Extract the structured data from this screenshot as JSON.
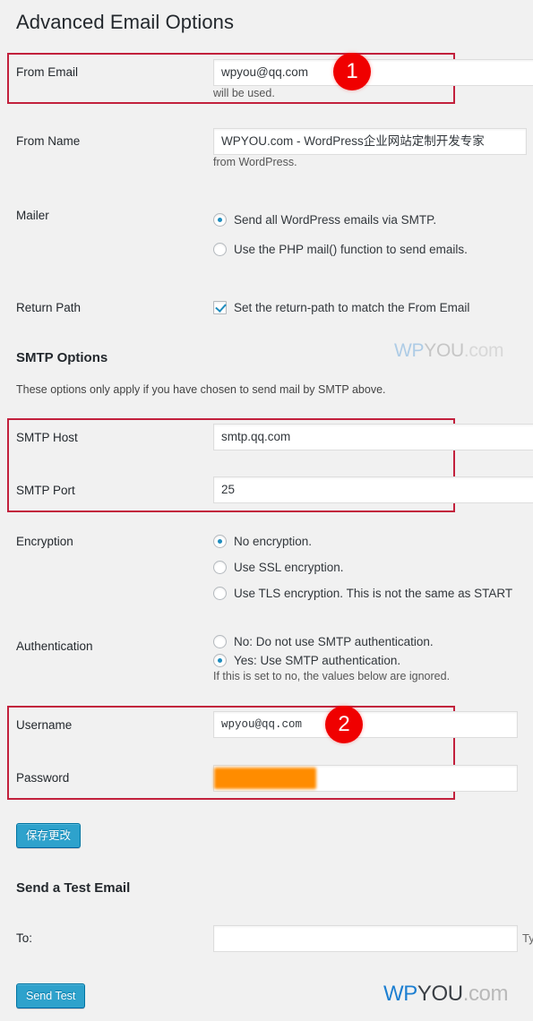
{
  "page": {
    "title": "Advanced Email Options",
    "background_color": "#f1f1f1"
  },
  "from_email": {
    "label": "From Email",
    "value": "wpyou@qq.com",
    "helper": "will be used."
  },
  "from_name": {
    "label": "From Name",
    "value": "WPYOU.com - WordPress企业网站定制开发专家",
    "helper": "from WordPress."
  },
  "mailer": {
    "label": "Mailer",
    "options": [
      {
        "label": "Send all WordPress emails via SMTP.",
        "selected": true
      },
      {
        "label": "Use the PHP mail() function to send emails.",
        "selected": false
      }
    ]
  },
  "return_path": {
    "label": "Return Path",
    "checkbox_label": "Set the return-path to match the From Email",
    "checked": true
  },
  "smtp_options": {
    "title": "SMTP Options",
    "description": "These options only apply if you have chosen to send mail by SMTP above.",
    "host": {
      "label": "SMTP Host",
      "value": "smtp.qq.com"
    },
    "port": {
      "label": "SMTP Port",
      "value": "25"
    }
  },
  "encryption": {
    "label": "Encryption",
    "options": [
      {
        "label": "No encryption.",
        "selected": true
      },
      {
        "label": "Use SSL encryption.",
        "selected": false
      },
      {
        "label": "Use TLS encryption. This is not the same as START",
        "selected": false
      }
    ]
  },
  "authentication": {
    "label": "Authentication",
    "options": [
      {
        "label": "No: Do not use SMTP authentication.",
        "selected": false
      },
      {
        "label": "Yes: Use SMTP authentication.",
        "selected": true
      }
    ],
    "helper": "If this is set to no, the values below are ignored."
  },
  "credentials": {
    "username": {
      "label": "Username",
      "value": "wpyou@qq.com"
    },
    "password": {
      "label": "Password",
      "value": ""
    }
  },
  "save_button": {
    "label": "保存更改"
  },
  "test_email": {
    "title": "Send a Test Email",
    "to_label": "To:",
    "to_value": "",
    "to_hint_clipped": "Ty",
    "send_button": "Send Test"
  },
  "annotations": {
    "badge_one": "1",
    "badge_two": "2",
    "highlight_color": "#c2203c",
    "badge_color": "#f00000",
    "redaction_color": "#ff8c00"
  },
  "watermark": {
    "wp": "WP",
    "you": "YOU",
    "dot": ".com"
  },
  "logo": {
    "wp": "WP",
    "you": "YOU",
    "dot": ".com"
  }
}
